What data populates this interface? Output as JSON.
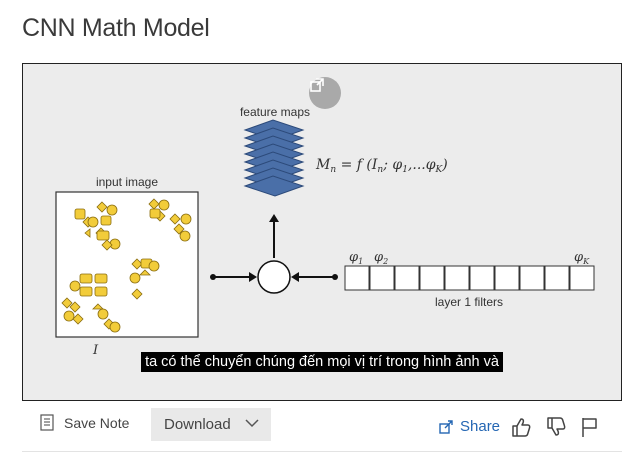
{
  "page": {
    "title": "CNN Math Model"
  },
  "video": {
    "caption": "ta có thể chuyển chúng đến mọi vị trí trong hình ảnh và",
    "slide": {
      "feature_maps_label": "feature maps",
      "formula_main": "M",
      "formula_sub_n": "n",
      "formula_rest": " = f (I",
      "formula_tail": "; φ",
      "formula_mid": ",...φ",
      "formula_end": ")",
      "formula_sub_1": "1",
      "formula_sub_K": "K",
      "input_image_label": "input image",
      "input_symbol": "I",
      "phi1": "φ",
      "phi1_sub": "1",
      "phi2": "φ",
      "phi2_sub": "2",
      "phiK": "φ",
      "phiK_sub": "K",
      "filters_label": "layer 1 filters"
    }
  },
  "toolbar": {
    "save_note_label": "Save Note",
    "download_label": "Download",
    "share_label": "Share"
  },
  "icons": {
    "popout": "popout-icon",
    "note": "note-icon",
    "chevron": "chevron-down-icon",
    "share": "share-icon",
    "like": "thumbs-up-icon",
    "dislike": "thumbs-down-icon",
    "flag": "flag-icon"
  },
  "colors": {
    "feature_map": "#4a6fa8",
    "shape_fill": "#f2cc3a",
    "link": "#2466b3"
  }
}
